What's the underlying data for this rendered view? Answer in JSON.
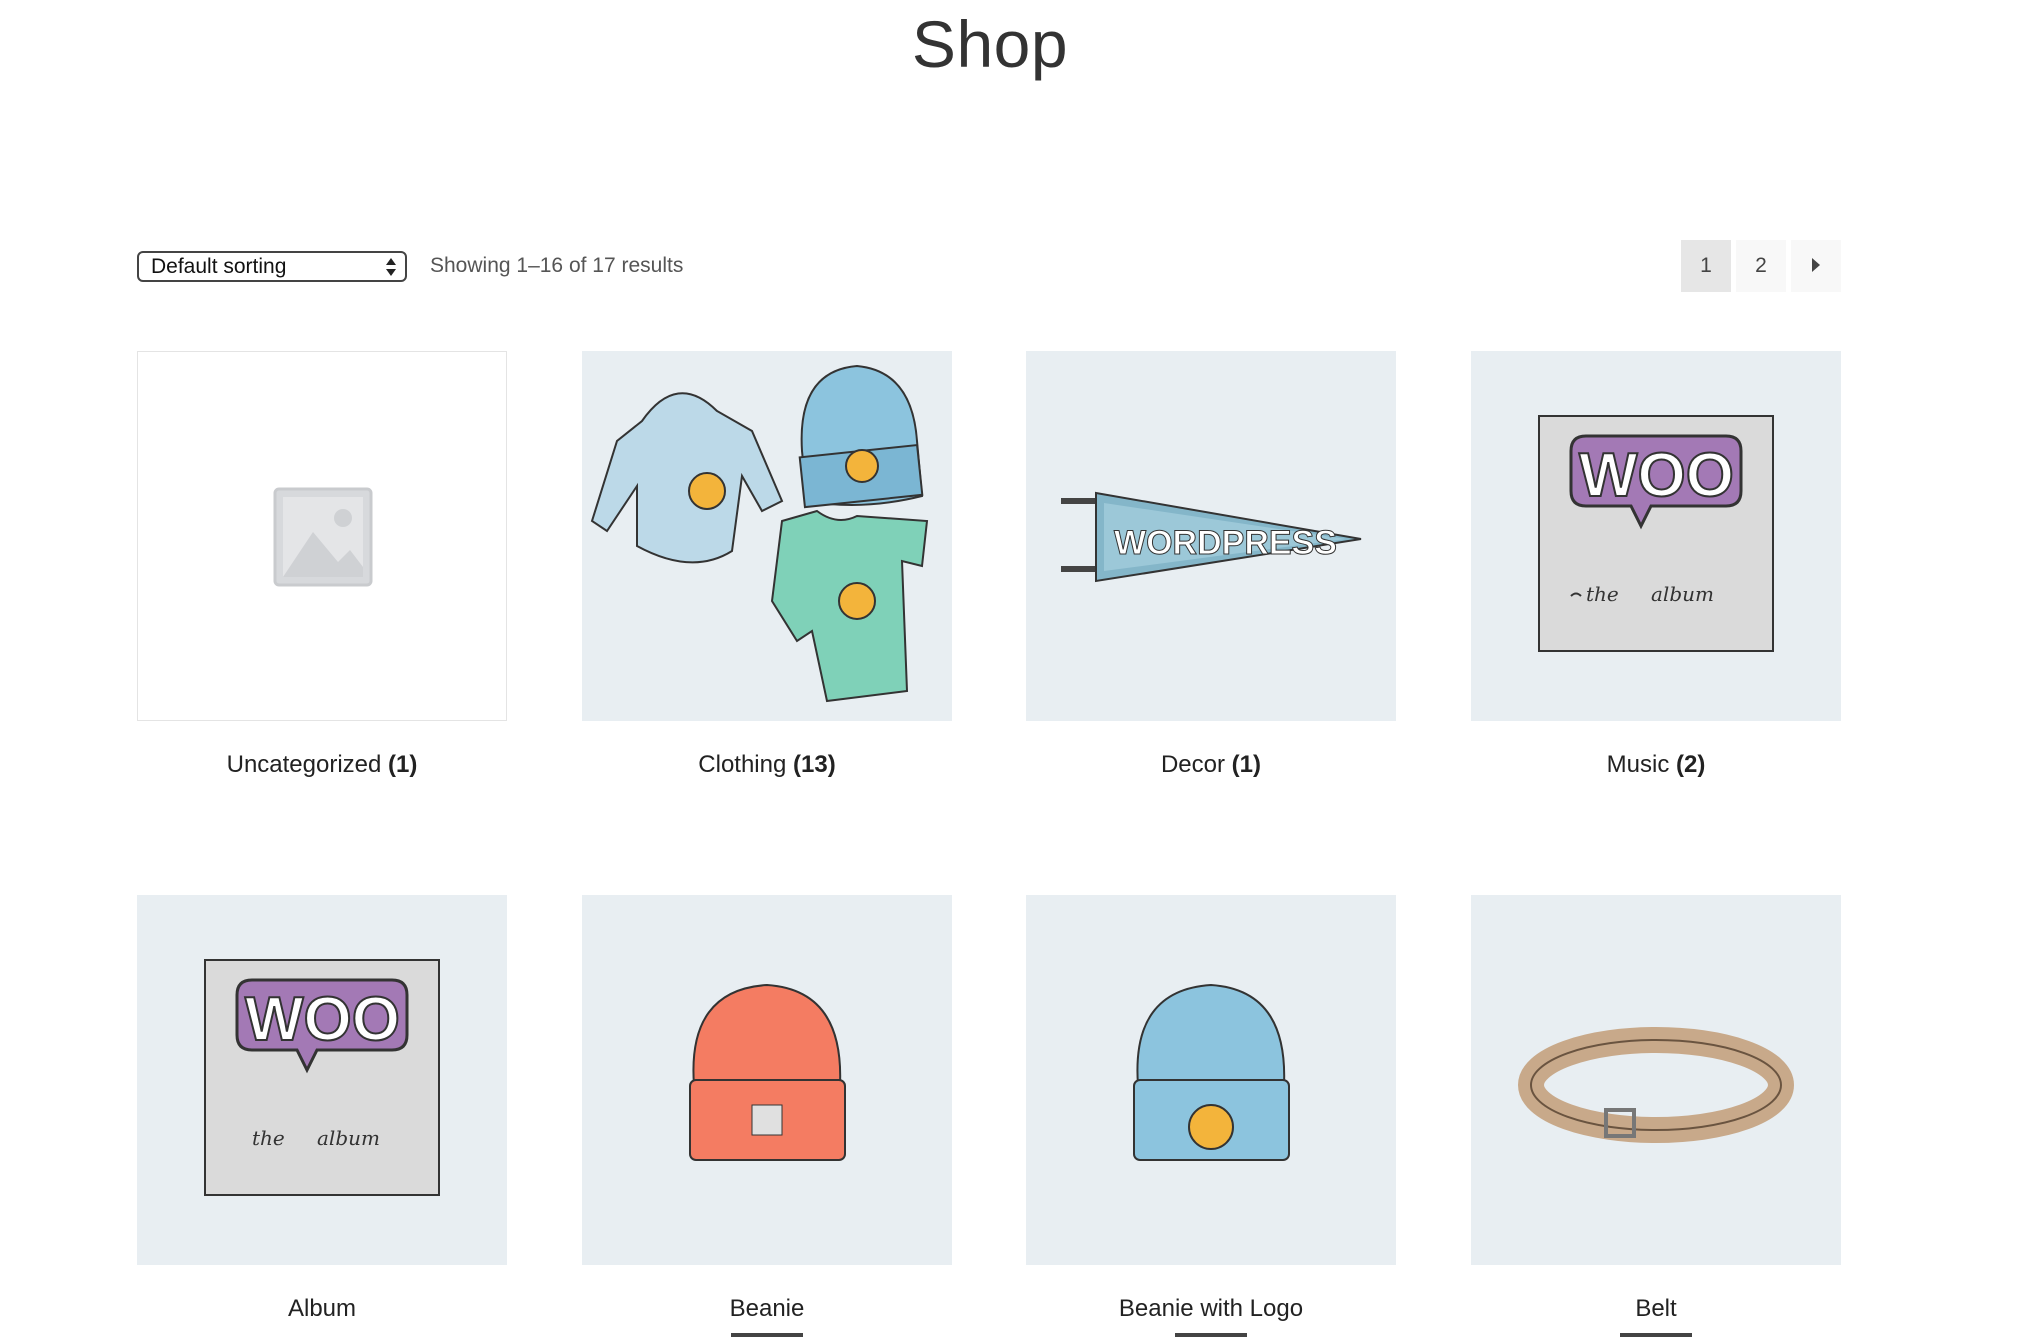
{
  "page": {
    "title": "Shop"
  },
  "toolbar": {
    "sort_label": "Default sorting",
    "result_count": "Showing 1–16 of 17 results",
    "pages": [
      "1",
      "2"
    ],
    "current_page": "1"
  },
  "categories": [
    {
      "name": "Uncategorized",
      "count": "(1)"
    },
    {
      "name": "Clothing",
      "count": "(13)"
    },
    {
      "name": "Decor",
      "count": "(1)"
    },
    {
      "name": "Music",
      "count": "(2)"
    }
  ],
  "products": [
    {
      "name": "Album"
    },
    {
      "name": "Beanie"
    },
    {
      "name": "Beanie with Logo"
    },
    {
      "name": "Belt"
    }
  ],
  "colors": {
    "thumb_bg": "#e8eef2",
    "beanie_red": "#f47c62",
    "beanie_blue": "#8cc4de",
    "woo_purple": "#9b6fb0"
  }
}
